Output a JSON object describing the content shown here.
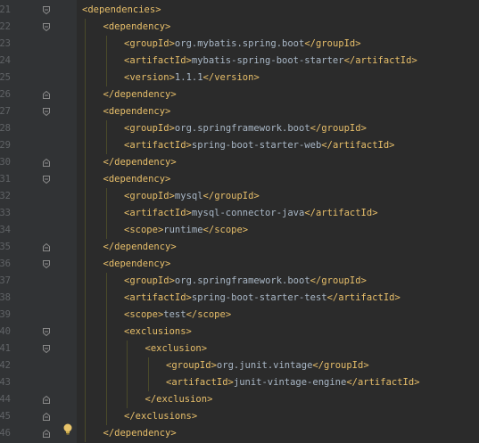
{
  "editor": {
    "lines": [
      {
        "num": "21",
        "indent": 0,
        "parts": [
          [
            "b",
            "<"
          ],
          [
            "t",
            "dependencies"
          ],
          [
            "b",
            ">"
          ]
        ],
        "fold": "open"
      },
      {
        "num": "22",
        "indent": 1,
        "parts": [
          [
            "b",
            "<"
          ],
          [
            "t",
            "dependency"
          ],
          [
            "b",
            ">"
          ]
        ],
        "fold": "open"
      },
      {
        "num": "23",
        "indent": 2,
        "parts": [
          [
            "b",
            "<"
          ],
          [
            "t",
            "groupId"
          ],
          [
            "b",
            ">"
          ],
          [
            "x",
            "org.mybatis.spring.boot"
          ],
          [
            "b",
            "</"
          ],
          [
            "t",
            "groupId"
          ],
          [
            "b",
            ">"
          ]
        ],
        "fold": ""
      },
      {
        "num": "24",
        "indent": 2,
        "parts": [
          [
            "b",
            "<"
          ],
          [
            "t",
            "artifactId"
          ],
          [
            "b",
            ">"
          ],
          [
            "x",
            "mybatis-spring-boot-starter"
          ],
          [
            "b",
            "</"
          ],
          [
            "t",
            "artifactId"
          ],
          [
            "b",
            ">"
          ]
        ],
        "fold": ""
      },
      {
        "num": "25",
        "indent": 2,
        "parts": [
          [
            "b",
            "<"
          ],
          [
            "t",
            "version"
          ],
          [
            "b",
            ">"
          ],
          [
            "x",
            "1.1.1"
          ],
          [
            "b",
            "</"
          ],
          [
            "t",
            "version"
          ],
          [
            "b",
            ">"
          ]
        ],
        "fold": ""
      },
      {
        "num": "26",
        "indent": 1,
        "parts": [
          [
            "b",
            "</"
          ],
          [
            "t",
            "dependency"
          ],
          [
            "b",
            ">"
          ]
        ],
        "fold": "close"
      },
      {
        "num": "27",
        "indent": 1,
        "parts": [
          [
            "b",
            "<"
          ],
          [
            "t",
            "dependency"
          ],
          [
            "b",
            ">"
          ]
        ],
        "fold": "open"
      },
      {
        "num": "28",
        "indent": 2,
        "parts": [
          [
            "b",
            "<"
          ],
          [
            "t",
            "groupId"
          ],
          [
            "b",
            ">"
          ],
          [
            "x",
            "org.springframework.boot"
          ],
          [
            "b",
            "</"
          ],
          [
            "t",
            "groupId"
          ],
          [
            "b",
            ">"
          ]
        ],
        "fold": ""
      },
      {
        "num": "29",
        "indent": 2,
        "parts": [
          [
            "b",
            "<"
          ],
          [
            "t",
            "artifactId"
          ],
          [
            "b",
            ">"
          ],
          [
            "x",
            "spring-boot-starter-web"
          ],
          [
            "b",
            "</"
          ],
          [
            "t",
            "artifactId"
          ],
          [
            "b",
            ">"
          ]
        ],
        "fold": ""
      },
      {
        "num": "30",
        "indent": 1,
        "parts": [
          [
            "b",
            "</"
          ],
          [
            "t",
            "dependency"
          ],
          [
            "b",
            ">"
          ]
        ],
        "fold": "close"
      },
      {
        "num": "31",
        "indent": 1,
        "parts": [
          [
            "b",
            "<"
          ],
          [
            "t",
            "dependency"
          ],
          [
            "b",
            ">"
          ]
        ],
        "fold": "open"
      },
      {
        "num": "32",
        "indent": 2,
        "parts": [
          [
            "b",
            "<"
          ],
          [
            "t",
            "groupId"
          ],
          [
            "b",
            ">"
          ],
          [
            "x",
            "mysql"
          ],
          [
            "b",
            "</"
          ],
          [
            "t",
            "groupId"
          ],
          [
            "b",
            ">"
          ]
        ],
        "fold": ""
      },
      {
        "num": "33",
        "indent": 2,
        "parts": [
          [
            "b",
            "<"
          ],
          [
            "t",
            "artifactId"
          ],
          [
            "b",
            ">"
          ],
          [
            "x",
            "mysql-connector-java"
          ],
          [
            "b",
            "</"
          ],
          [
            "t",
            "artifactId"
          ],
          [
            "b",
            ">"
          ]
        ],
        "fold": ""
      },
      {
        "num": "34",
        "indent": 2,
        "parts": [
          [
            "b",
            "<"
          ],
          [
            "t",
            "scope"
          ],
          [
            "b",
            ">"
          ],
          [
            "x",
            "runtime"
          ],
          [
            "b",
            "</"
          ],
          [
            "t",
            "scope"
          ],
          [
            "b",
            ">"
          ]
        ],
        "fold": ""
      },
      {
        "num": "35",
        "indent": 1,
        "parts": [
          [
            "b",
            "</"
          ],
          [
            "t",
            "dependency"
          ],
          [
            "b",
            ">"
          ]
        ],
        "fold": "close"
      },
      {
        "num": "36",
        "indent": 1,
        "parts": [
          [
            "b",
            "<"
          ],
          [
            "t",
            "dependency"
          ],
          [
            "b",
            ">"
          ]
        ],
        "fold": "open"
      },
      {
        "num": "37",
        "indent": 2,
        "parts": [
          [
            "b",
            "<"
          ],
          [
            "t",
            "groupId"
          ],
          [
            "b",
            ">"
          ],
          [
            "x",
            "org.springframework.boot"
          ],
          [
            "b",
            "</"
          ],
          [
            "t",
            "groupId"
          ],
          [
            "b",
            ">"
          ]
        ],
        "fold": ""
      },
      {
        "num": "38",
        "indent": 2,
        "parts": [
          [
            "b",
            "<"
          ],
          [
            "t",
            "artifactId"
          ],
          [
            "b",
            ">"
          ],
          [
            "x",
            "spring-boot-starter-test"
          ],
          [
            "b",
            "</"
          ],
          [
            "t",
            "artifactId"
          ],
          [
            "b",
            ">"
          ]
        ],
        "fold": ""
      },
      {
        "num": "39",
        "indent": 2,
        "parts": [
          [
            "b",
            "<"
          ],
          [
            "t",
            "scope"
          ],
          [
            "b",
            ">"
          ],
          [
            "x",
            "test"
          ],
          [
            "b",
            "</"
          ],
          [
            "t",
            "scope"
          ],
          [
            "b",
            ">"
          ]
        ],
        "fold": ""
      },
      {
        "num": "40",
        "indent": 2,
        "parts": [
          [
            "b",
            "<"
          ],
          [
            "t",
            "exclusions"
          ],
          [
            "b",
            ">"
          ]
        ],
        "fold": "open"
      },
      {
        "num": "41",
        "indent": 3,
        "parts": [
          [
            "b",
            "<"
          ],
          [
            "t",
            "exclusion"
          ],
          [
            "b",
            ">"
          ]
        ],
        "fold": "open"
      },
      {
        "num": "42",
        "indent": 4,
        "parts": [
          [
            "b",
            "<"
          ],
          [
            "t",
            "groupId"
          ],
          [
            "b",
            ">"
          ],
          [
            "x",
            "org.junit.vintage"
          ],
          [
            "b",
            "</"
          ],
          [
            "t",
            "groupId"
          ],
          [
            "b",
            ">"
          ]
        ],
        "fold": ""
      },
      {
        "num": "43",
        "indent": 4,
        "parts": [
          [
            "b",
            "<"
          ],
          [
            "t",
            "artifactId"
          ],
          [
            "b",
            ">"
          ],
          [
            "x",
            "junit-vintage-engine"
          ],
          [
            "b",
            "</"
          ],
          [
            "t",
            "artifactId"
          ],
          [
            "b",
            ">"
          ]
        ],
        "fold": ""
      },
      {
        "num": "44",
        "indent": 3,
        "parts": [
          [
            "b",
            "</"
          ],
          [
            "t",
            "exclusion"
          ],
          [
            "b",
            ">"
          ]
        ],
        "fold": "close"
      },
      {
        "num": "45",
        "indent": 2,
        "parts": [
          [
            "b",
            "</"
          ],
          [
            "t",
            "exclusions"
          ],
          [
            "b",
            ">"
          ]
        ],
        "fold": "close"
      },
      {
        "num": "46",
        "indent": 1,
        "parts": [
          [
            "b",
            "</"
          ],
          [
            "t",
            "dependency"
          ],
          [
            "b",
            ">"
          ]
        ],
        "fold": "close"
      }
    ]
  },
  "gutter": {
    "intention_icon": "lightbulb-icon",
    "fold_open_icon": "fold-open-icon",
    "fold_close_icon": "fold-close-icon"
  },
  "colors": {
    "background": "#2b2b2b",
    "gutter": "#313335",
    "line_number": "#606366",
    "tag": "#e8bf6a",
    "text": "#a9b7c6",
    "indent_guide": "#4a4a2a",
    "bulb": "#e8c46a"
  }
}
